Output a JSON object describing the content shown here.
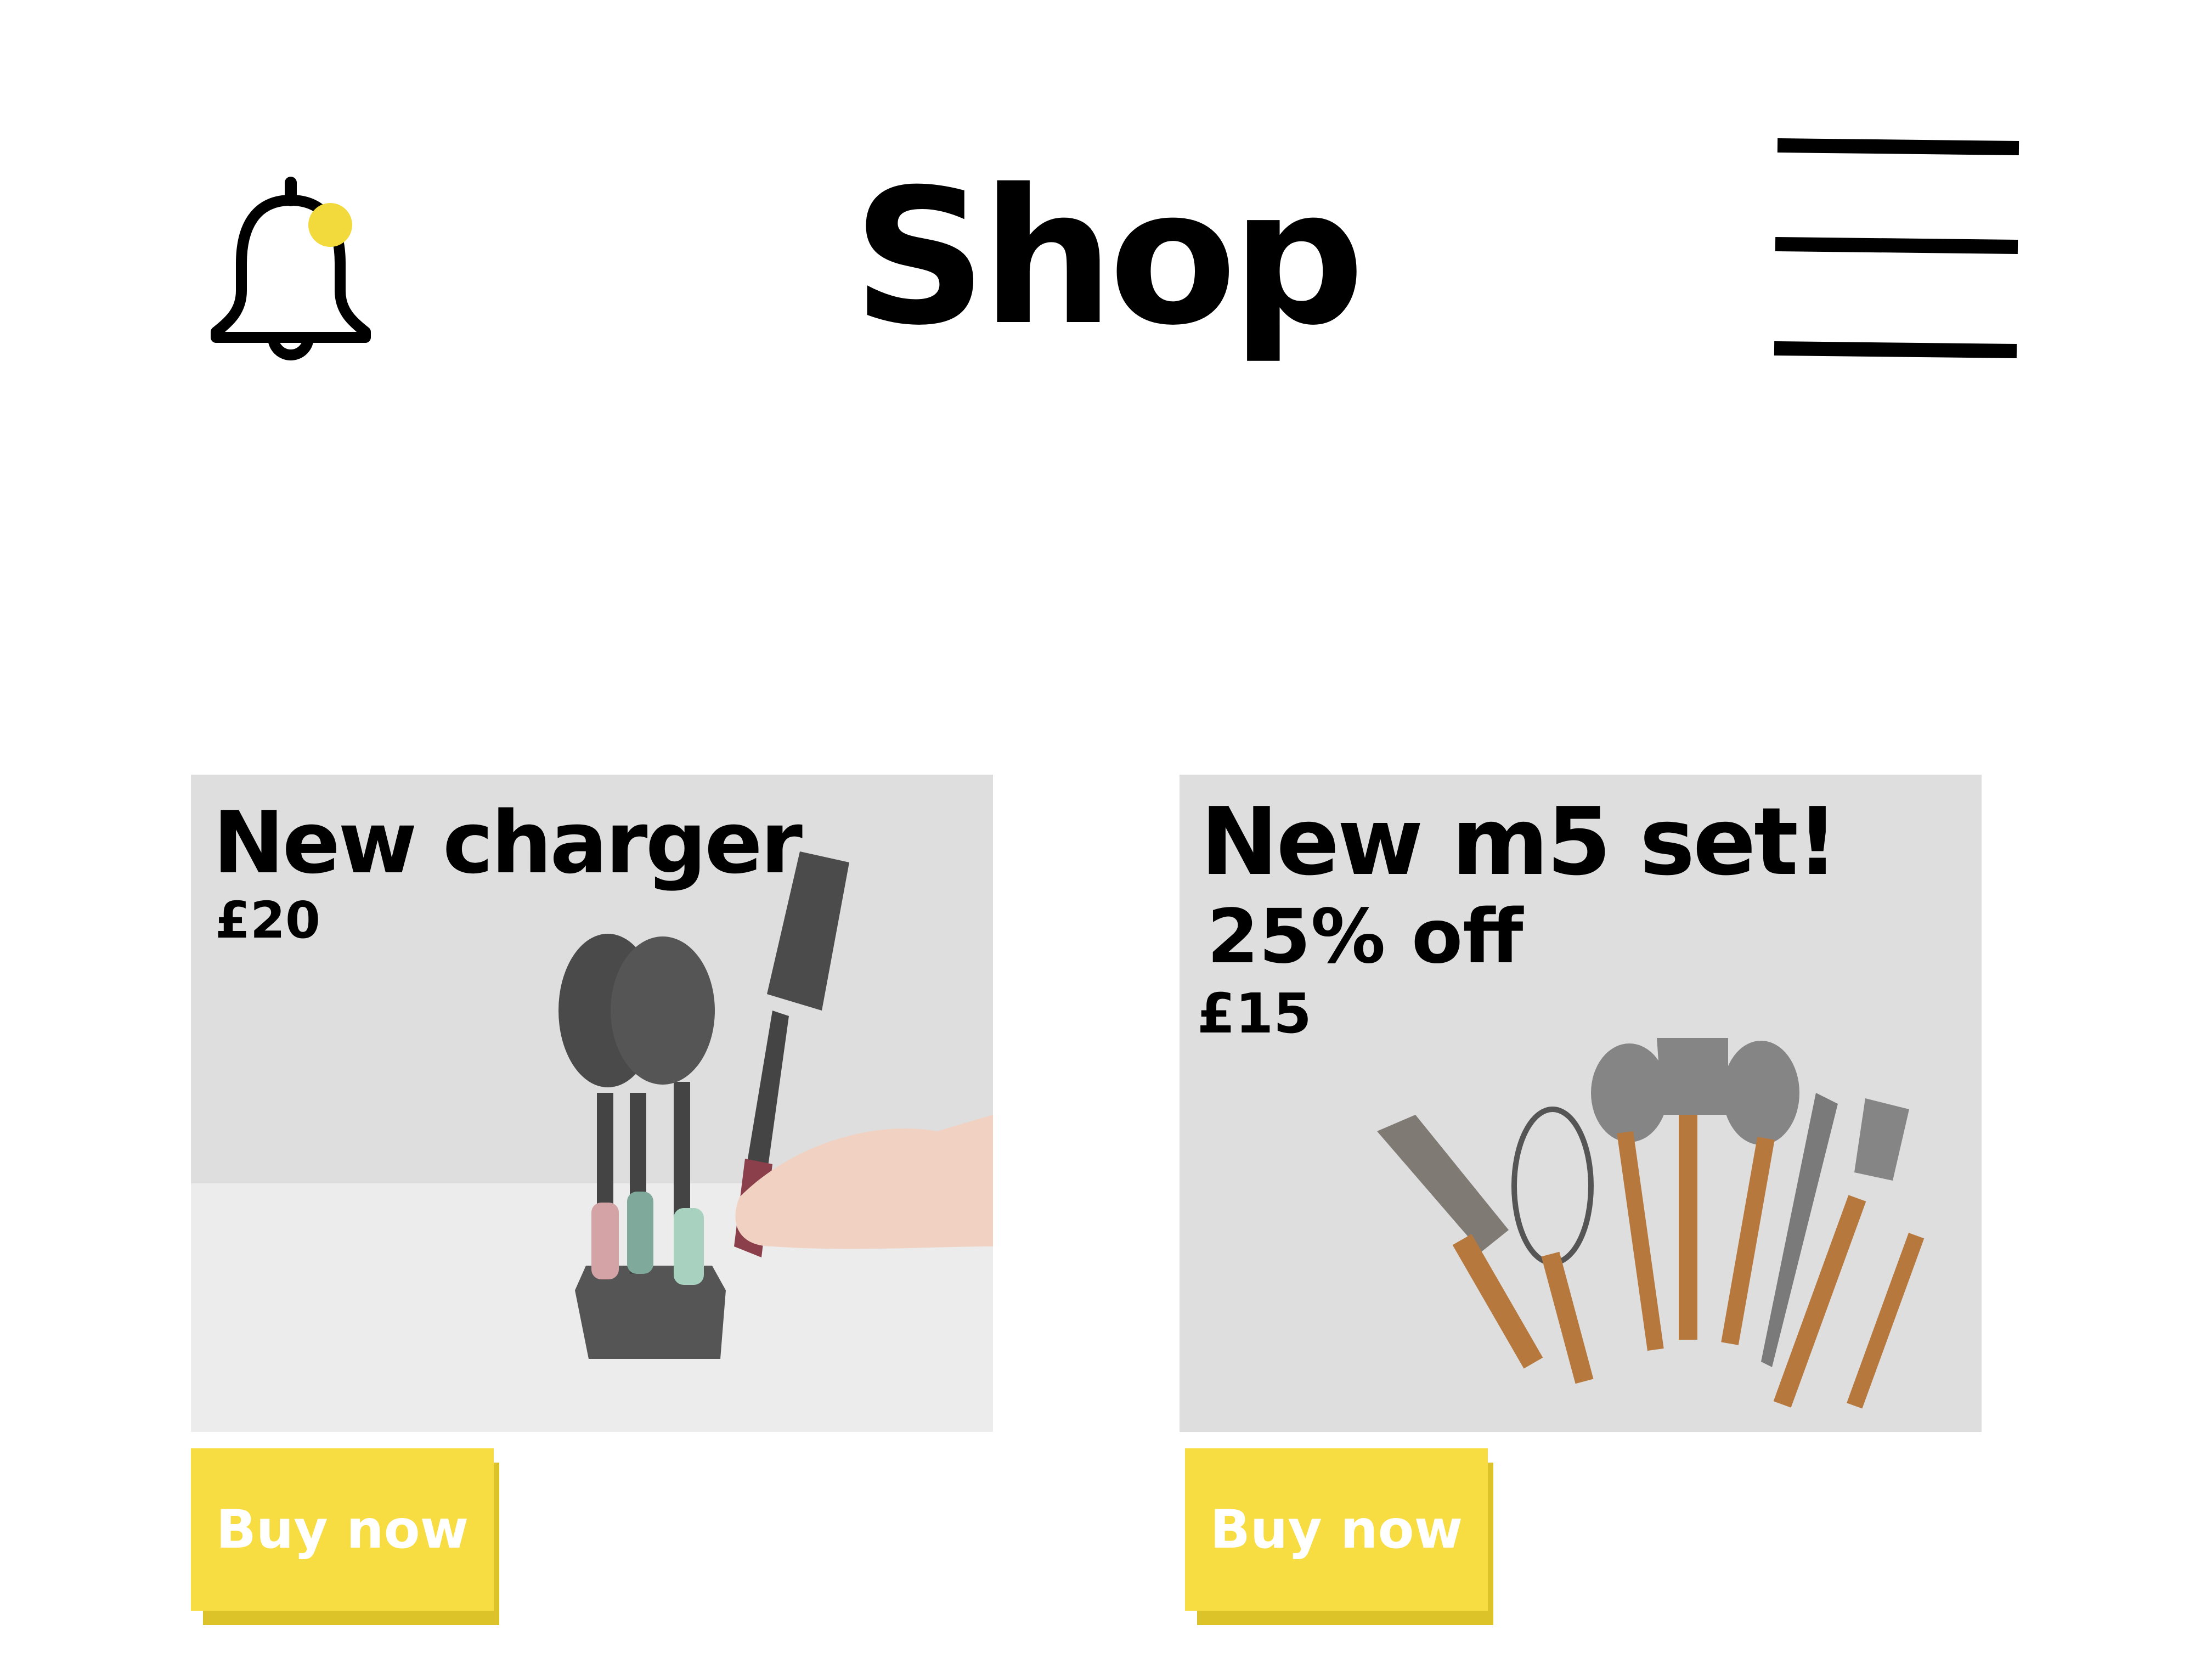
{
  "header": {
    "title": "Shop",
    "notification_icon": "bell-icon",
    "notification_dot_color": "#f2d93c",
    "menu_icon": "hamburger-menu-icon"
  },
  "products": [
    {
      "name": "New charger",
      "price": "£20",
      "image": "kitchen-utensil-set-with-stand",
      "button_label": "Buy now"
    },
    {
      "name": "New m5 set!",
      "discount": "25% off",
      "price": "£15",
      "image": "wooden-handle-kitchen-utensils",
      "button_label": "Buy now"
    }
  ],
  "colors": {
    "accent": "#f7dd42",
    "accent_shadow": "#dcc32a",
    "card_background": "#dedede",
    "text": "#000000"
  }
}
